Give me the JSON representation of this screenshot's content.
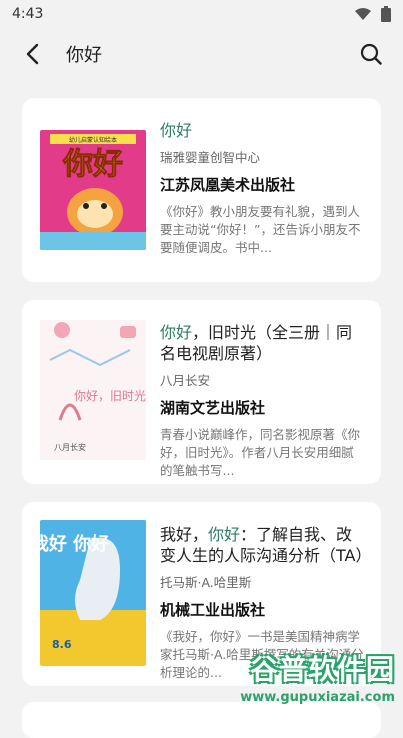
{
  "status": {
    "time": "4:43"
  },
  "topbar": {
    "search_text": "你好"
  },
  "books": [
    {
      "title_hl": "你好",
      "title_rest": "",
      "author": "瑞雅婴童创智中心",
      "publisher": "江苏凤凰美术出版社",
      "desc": "《你好》教小朋友要有礼貌，遇到人要主动说“你好！”，还告诉小朋友不要随便调皮。书中..."
    },
    {
      "title_hl": "你好",
      "title_rest": "，旧时光（全三册｜同名电视剧原著）",
      "author": "八月长安",
      "publisher": "湖南文艺出版社",
      "desc": "青春小说巅峰作，同名影视原著《你好，旧时光》。作者八月长安用细腻的笔触书写..."
    },
    {
      "title_pre": "我好，",
      "title_hl": "你好",
      "title_rest": "：了解自我、改变人生的人际沟通分析（TA）",
      "author": "托马斯·A.哈里斯",
      "publisher": "机械工业出版社",
      "desc": "《我好，你好》一书是美国精神病学家托马斯·A.哈里斯撰写的有关沟通分析理论的..."
    }
  ],
  "covers": {
    "c1": {
      "title": "你好",
      "banner": "幼儿启蒙认知绘本"
    },
    "c2": {
      "title": "你好，旧时光",
      "author": "八月长安"
    },
    "c3": {
      "title": "我好 你好",
      "numbers": "8.6"
    }
  },
  "watermark": {
    "main": "谷普软件园",
    "url": "www.gupuxiazai.com"
  }
}
